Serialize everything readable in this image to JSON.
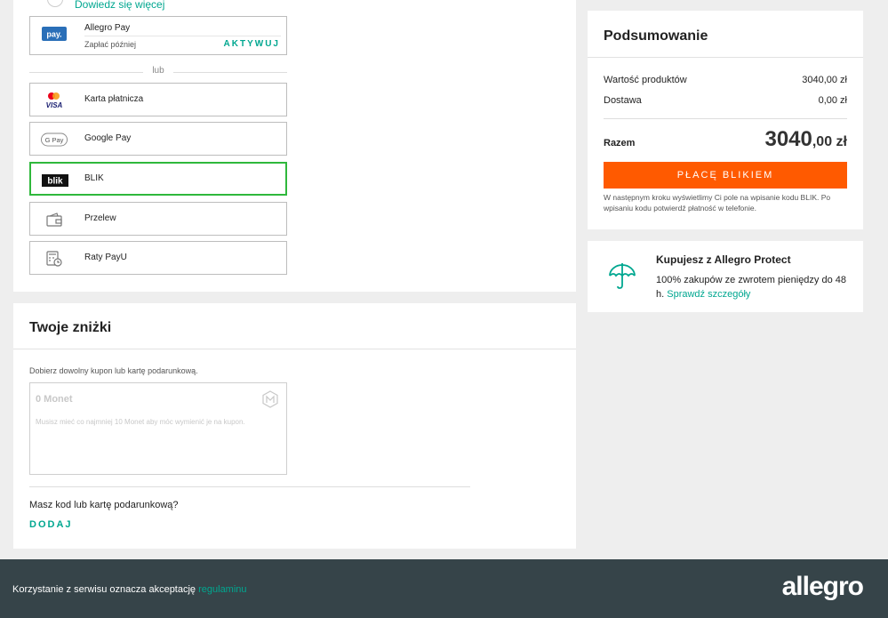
{
  "payment": {
    "learn_more": "Dowiedz się więcej",
    "allegro_pay": {
      "label": "Allegro Pay",
      "sub": "Zapłać później",
      "action": "AKTYWUJ",
      "logo_text": "pay."
    },
    "separator": "lub",
    "methods": [
      {
        "label": "Karta płatnicza",
        "icon": "mastercard-visa-icon",
        "logo_text": "VISA"
      },
      {
        "label": "Google Pay",
        "icon": "google-pay-icon",
        "logo_text": "G Pay"
      },
      {
        "label": "BLIK",
        "icon": "blik-icon",
        "logo_text": "blik",
        "selected": true
      },
      {
        "label": "Przelew",
        "icon": "wallet-icon"
      },
      {
        "label": "Raty PayU",
        "icon": "calculator-icon"
      }
    ]
  },
  "discounts": {
    "title": "Twoje zniżki",
    "hint": "Dobierz dowolny kupon lub kartę podarunkową.",
    "coupon": {
      "amount": "0 Monet",
      "desc": "Musisz mieć co najmniej 10 Monet aby móc wymienić je na kupon."
    },
    "question": "Masz kod lub kartę podarunkową?",
    "add": "DODAJ"
  },
  "summary": {
    "title": "Podsumowanie",
    "rows": [
      {
        "label": "Wartość produktów",
        "value": "3040,00 zł"
      },
      {
        "label": "Dostawa",
        "value": "0,00 zł"
      }
    ],
    "total_label": "Razem",
    "total_main": "3040",
    "total_decimal": ",00 zł",
    "pay_button": "PŁACĘ BLIKIEM",
    "note": "W następnym kroku wyświetlimy Ci pole na wpisanie kodu BLIK. Po wpisaniu kodu potwierdź płatność w telefonie."
  },
  "protect": {
    "title": "Kupujesz z Allegro Protect",
    "desc": "100% zakupów ze zwrotem pieniędzy do 48 h.",
    "link": "Sprawdź szczegóły"
  },
  "footer": {
    "text": "Korzystanie z serwisu oznacza akceptację",
    "link": "regulaminu",
    "logo": "allegro"
  },
  "colors": {
    "accent": "#00a790",
    "cta": "#ff5a00",
    "selected": "#2fb83c",
    "footer": "#364449"
  }
}
